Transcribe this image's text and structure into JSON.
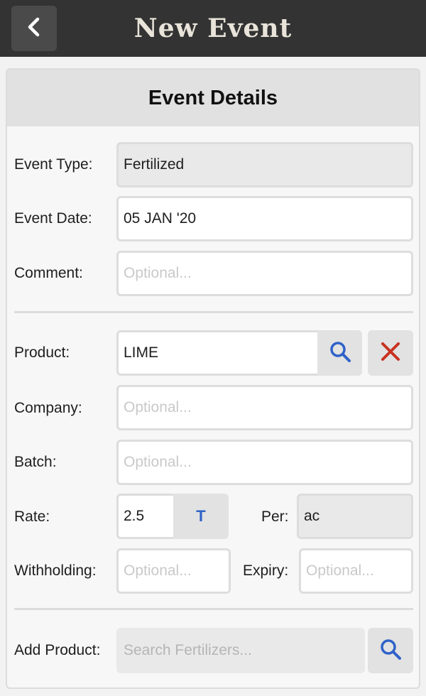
{
  "header": {
    "title": "New Event"
  },
  "section": {
    "title": "Event Details"
  },
  "event_type": {
    "label": "Event Type:",
    "value": "Fertilized"
  },
  "event_date": {
    "label": "Event Date:",
    "value": "05 JAN '20"
  },
  "comment": {
    "label": "Comment:",
    "placeholder": "Optional..."
  },
  "product": {
    "label": "Product:",
    "value": "LIME"
  },
  "company": {
    "label": "Company:",
    "placeholder": "Optional..."
  },
  "batch": {
    "label": "Batch:",
    "placeholder": "Optional..."
  },
  "rate": {
    "label": "Rate:",
    "value": "2.5",
    "unit": "T"
  },
  "per": {
    "label": "Per:",
    "value": "ac"
  },
  "withholding": {
    "label": "Withholding:",
    "placeholder": "Optional..."
  },
  "expiry": {
    "label": "Expiry:",
    "placeholder": "Optional..."
  },
  "add_product": {
    "label": "Add Product:",
    "placeholder": "Search Fertilizers..."
  },
  "colors": {
    "topbar": "#333333",
    "accent_blue": "#2f62c9",
    "clear_red": "#c8321f"
  },
  "icons": {
    "back": "chevron-left-icon",
    "search": "search-icon",
    "clear": "close-icon"
  }
}
